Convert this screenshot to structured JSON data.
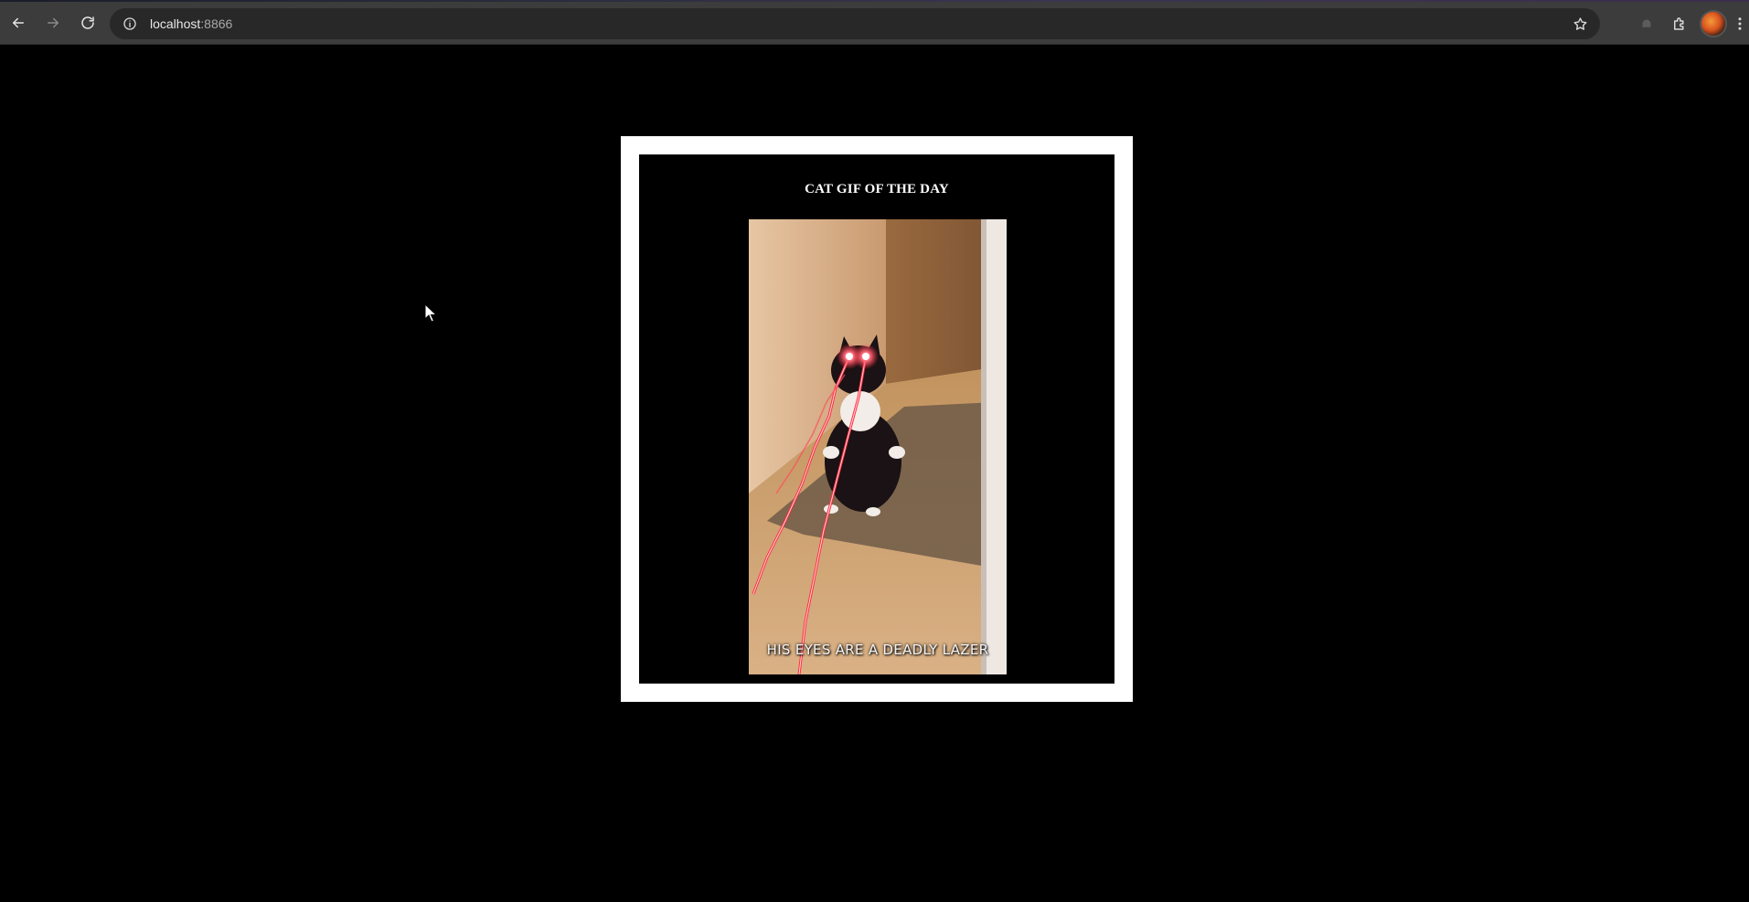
{
  "browser": {
    "url_host": "localhost",
    "url_port": ":8866",
    "icons": [
      "back-icon",
      "forward-icon",
      "reload-icon",
      "site-info-icon",
      "bookmark-star-icon",
      "extension-puzzle-icon",
      "profile-avatar",
      "kebab-menu-icon"
    ]
  },
  "page": {
    "title": "CAT GIF OF THE DAY",
    "gif_caption": "HIS EYES ARE A DEADLY LAZER"
  },
  "colors": {
    "page_background": "#000000",
    "card_border": "#ffffff",
    "laser": "#ff2a3d"
  }
}
